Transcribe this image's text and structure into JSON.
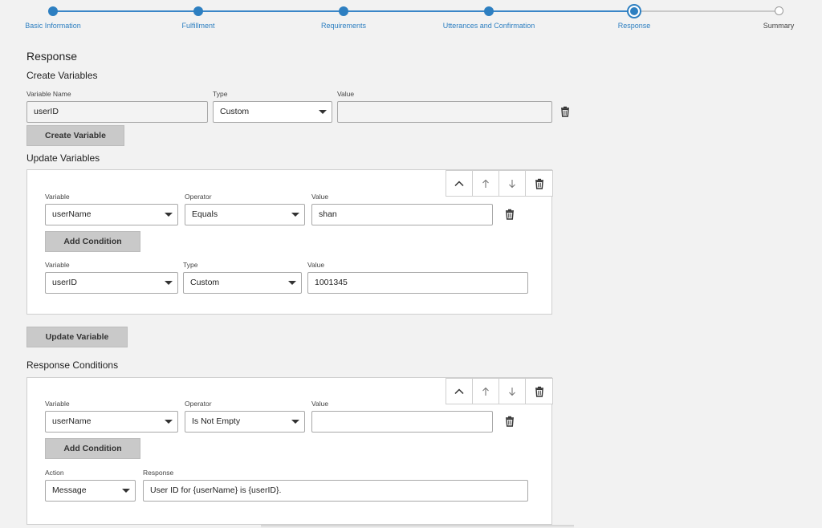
{
  "stepper": {
    "steps": [
      {
        "label": "Basic Information"
      },
      {
        "label": "Fulfillment"
      },
      {
        "label": "Requirements"
      },
      {
        "label": "Utterances and Confirmation"
      },
      {
        "label": "Response"
      },
      {
        "label": "Summary"
      }
    ],
    "current_index": 4
  },
  "page_title": "Response",
  "create_variables": {
    "heading": "Create Variables",
    "name_label": "Variable Name",
    "name_value": "userID",
    "type_label": "Type",
    "type_value": "Custom",
    "value_label": "Value",
    "value_value": "",
    "create_button": "Create Variable"
  },
  "update_variables": {
    "heading": "Update Variables",
    "condition": {
      "variable_label": "Variable",
      "variable_value": "userName",
      "operator_label": "Operator",
      "operator_value": "Equals",
      "value_label": "Value",
      "value_value": "shan"
    },
    "add_condition_button": "Add Condition",
    "assignment": {
      "variable_label": "Variable",
      "variable_value": "userID",
      "type_label": "Type",
      "type_value": "Custom",
      "value_label": "Value",
      "value_value": "1001345"
    },
    "update_button": "Update Variable"
  },
  "response_conditions": {
    "heading": "Response Conditions",
    "condition": {
      "variable_label": "Variable",
      "variable_value": "userName",
      "operator_label": "Operator",
      "operator_value": "Is Not Empty",
      "value_label": "Value",
      "value_value": ""
    },
    "add_condition_button": "Add Condition",
    "action_label": "Action",
    "action_value": "Message",
    "response_label": "Response",
    "response_value": "User ID for {userName} is {userID}."
  },
  "icons": {
    "trash": "trash-icon",
    "chevron_up": "chevron-up-icon",
    "arrow_up": "arrow-up-icon",
    "arrow_down": "arrow-down-icon"
  },
  "colors": {
    "accent": "#2d7fc1",
    "button_bg": "#c9c9c9",
    "page_bg": "#f2f2f2"
  }
}
